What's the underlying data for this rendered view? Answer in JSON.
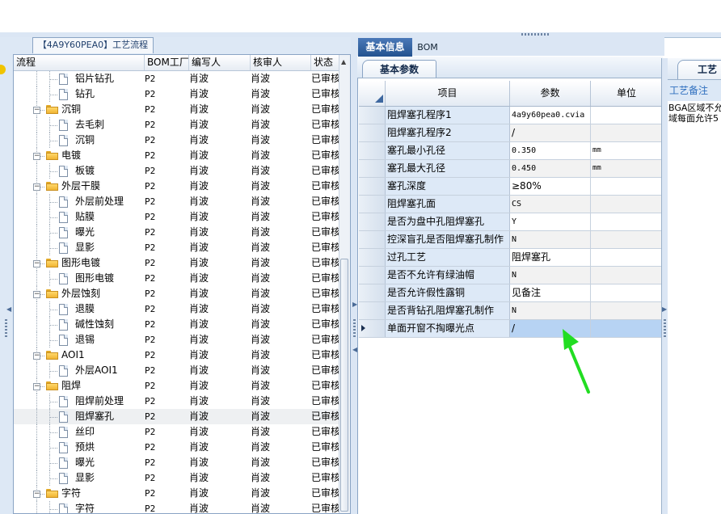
{
  "left_panel": {
    "tab_title": "【4A9Y60PEA0】工艺流程",
    "columns": [
      "流程",
      "BOM工厂",
      "编写人",
      "核审人",
      "状态"
    ],
    "rows": [
      {
        "level": 2,
        "type": "doc",
        "name": "铝片钻孔",
        "bom": "P2",
        "writer": "肖波",
        "reviewer": "肖波",
        "status": "已审核"
      },
      {
        "level": 2,
        "type": "doc",
        "name": "钻孔",
        "bom": "P2",
        "writer": "肖波",
        "reviewer": "肖波",
        "status": "已审核"
      },
      {
        "level": 1,
        "type": "folder",
        "name": "沉铜",
        "bom": "P2",
        "writer": "肖波",
        "reviewer": "肖波",
        "status": "已审核"
      },
      {
        "level": 2,
        "type": "doc",
        "name": "去毛刺",
        "bom": "P2",
        "writer": "肖波",
        "reviewer": "肖波",
        "status": "已审核"
      },
      {
        "level": 2,
        "type": "doc",
        "name": "沉铜",
        "bom": "P2",
        "writer": "肖波",
        "reviewer": "肖波",
        "status": "已审核"
      },
      {
        "level": 1,
        "type": "folder",
        "name": "电镀",
        "bom": "P2",
        "writer": "肖波",
        "reviewer": "肖波",
        "status": "已审核"
      },
      {
        "level": 2,
        "type": "doc",
        "name": "板镀",
        "bom": "P2",
        "writer": "肖波",
        "reviewer": "肖波",
        "status": "已审核"
      },
      {
        "level": 1,
        "type": "folder",
        "name": "外层干膜",
        "bom": "P2",
        "writer": "肖波",
        "reviewer": "肖波",
        "status": "已审核"
      },
      {
        "level": 2,
        "type": "doc",
        "name": "外层前处理",
        "bom": "P2",
        "writer": "肖波",
        "reviewer": "肖波",
        "status": "已审核"
      },
      {
        "level": 2,
        "type": "doc",
        "name": "贴膜",
        "bom": "P2",
        "writer": "肖波",
        "reviewer": "肖波",
        "status": "已审核"
      },
      {
        "level": 2,
        "type": "doc",
        "name": "曝光",
        "bom": "P2",
        "writer": "肖波",
        "reviewer": "肖波",
        "status": "已审核"
      },
      {
        "level": 2,
        "type": "doc",
        "name": "显影",
        "bom": "P2",
        "writer": "肖波",
        "reviewer": "肖波",
        "status": "已审核"
      },
      {
        "level": 1,
        "type": "folder",
        "name": "图形电镀",
        "bom": "P2",
        "writer": "肖波",
        "reviewer": "肖波",
        "status": "已审核"
      },
      {
        "level": 2,
        "type": "doc",
        "name": "图形电镀",
        "bom": "P2",
        "writer": "肖波",
        "reviewer": "肖波",
        "status": "已审核"
      },
      {
        "level": 1,
        "type": "folder",
        "name": "外层蚀刻",
        "bom": "P2",
        "writer": "肖波",
        "reviewer": "肖波",
        "status": "已审核"
      },
      {
        "level": 2,
        "type": "doc",
        "name": "退膜",
        "bom": "P2",
        "writer": "肖波",
        "reviewer": "肖波",
        "status": "已审核"
      },
      {
        "level": 2,
        "type": "doc",
        "name": "碱性蚀刻",
        "bom": "P2",
        "writer": "肖波",
        "reviewer": "肖波",
        "status": "已审核"
      },
      {
        "level": 2,
        "type": "doc",
        "name": "退锡",
        "bom": "P2",
        "writer": "肖波",
        "reviewer": "肖波",
        "status": "已审核"
      },
      {
        "level": 1,
        "type": "folder",
        "name": "AOI1",
        "bom": "P2",
        "writer": "肖波",
        "reviewer": "肖波",
        "status": "已审核"
      },
      {
        "level": 2,
        "type": "doc",
        "name": "外层AOI1",
        "bom": "P2",
        "writer": "肖波",
        "reviewer": "肖波",
        "status": "已审核"
      },
      {
        "level": 1,
        "type": "folder",
        "name": "阻焊",
        "bom": "P2",
        "writer": "肖波",
        "reviewer": "肖波",
        "status": "已审核"
      },
      {
        "level": 2,
        "type": "doc",
        "name": "阻焊前处理",
        "bom": "P2",
        "writer": "肖波",
        "reviewer": "肖波",
        "status": "已审核"
      },
      {
        "level": 2,
        "type": "doc",
        "name": "阻焊塞孔",
        "bom": "P2",
        "writer": "肖波",
        "reviewer": "肖波",
        "status": "已审核",
        "selected": true
      },
      {
        "level": 2,
        "type": "doc",
        "name": "丝印",
        "bom": "P2",
        "writer": "肖波",
        "reviewer": "肖波",
        "status": "已审核"
      },
      {
        "level": 2,
        "type": "doc",
        "name": "预烘",
        "bom": "P2",
        "writer": "肖波",
        "reviewer": "肖波",
        "status": "已审核"
      },
      {
        "level": 2,
        "type": "doc",
        "name": "曝光",
        "bom": "P2",
        "writer": "肖波",
        "reviewer": "肖波",
        "status": "已审核"
      },
      {
        "level": 2,
        "type": "doc",
        "name": "显影",
        "bom": "P2",
        "writer": "肖波",
        "reviewer": "肖波",
        "status": "已审核"
      },
      {
        "level": 1,
        "type": "folder",
        "name": "字符",
        "bom": "P2",
        "writer": "肖波",
        "reviewer": "肖波",
        "status": "已审核"
      },
      {
        "level": 2,
        "type": "doc",
        "name": "字符",
        "bom": "P2",
        "writer": "肖波",
        "reviewer": "肖波",
        "status": "已审核"
      }
    ]
  },
  "middle_panel": {
    "tabs": [
      {
        "label": "基本信息",
        "active": true
      },
      {
        "label": "BOM",
        "active": false
      }
    ],
    "sub_tab": "基本参数",
    "columns": [
      "项目",
      "参数",
      "单位"
    ],
    "rows": [
      {
        "item": "阻焊塞孔程序1",
        "value": "4a9y60pea0.cvia",
        "unit": "",
        "mono": true
      },
      {
        "item": "阻焊塞孔程序2",
        "value": "/",
        "unit": "",
        "alt": true
      },
      {
        "item": "塞孔最小孔径",
        "value": "0.350",
        "unit": "mm",
        "mono": true
      },
      {
        "item": "塞孔最大孔径",
        "value": "0.450",
        "unit": "mm",
        "mono": true,
        "alt": true
      },
      {
        "item": "塞孔深度",
        "value": "≥80%",
        "unit": ""
      },
      {
        "item": "阻焊塞孔面",
        "value": "CS",
        "unit": "",
        "mono": true,
        "alt": true
      },
      {
        "item": "是否为盘中孔阻焊塞孔",
        "value": "Y",
        "unit": "",
        "mono": true
      },
      {
        "item": "控深盲孔是否阻焊塞孔制作",
        "value": "N",
        "unit": "",
        "mono": true,
        "alt": true
      },
      {
        "item": "过孔工艺",
        "value": "阻焊塞孔",
        "unit": ""
      },
      {
        "item": "是否不允许有绿油帽",
        "value": "N",
        "unit": "",
        "mono": true,
        "alt": true
      },
      {
        "item": "是否允许假性露铜",
        "value": "见备注",
        "unit": ""
      },
      {
        "item": "是否背钻孔阻焊塞孔制作",
        "value": "N",
        "unit": "",
        "mono": true,
        "alt": true
      },
      {
        "item": "单面开窗不掏曝光点",
        "value": "/",
        "unit": "",
        "active": true,
        "current": true
      }
    ]
  },
  "right_panel": {
    "tab_title": "工艺",
    "notes_label": "工艺备注",
    "notes_text": "BGA区域不允\n域每面允许5"
  },
  "colors": {
    "accent_tab": "#23528f",
    "item_cell_bg": "#dde9f7",
    "active_cell_bg": "#b7d3f3",
    "annotation_arrow": "#22dd22"
  }
}
